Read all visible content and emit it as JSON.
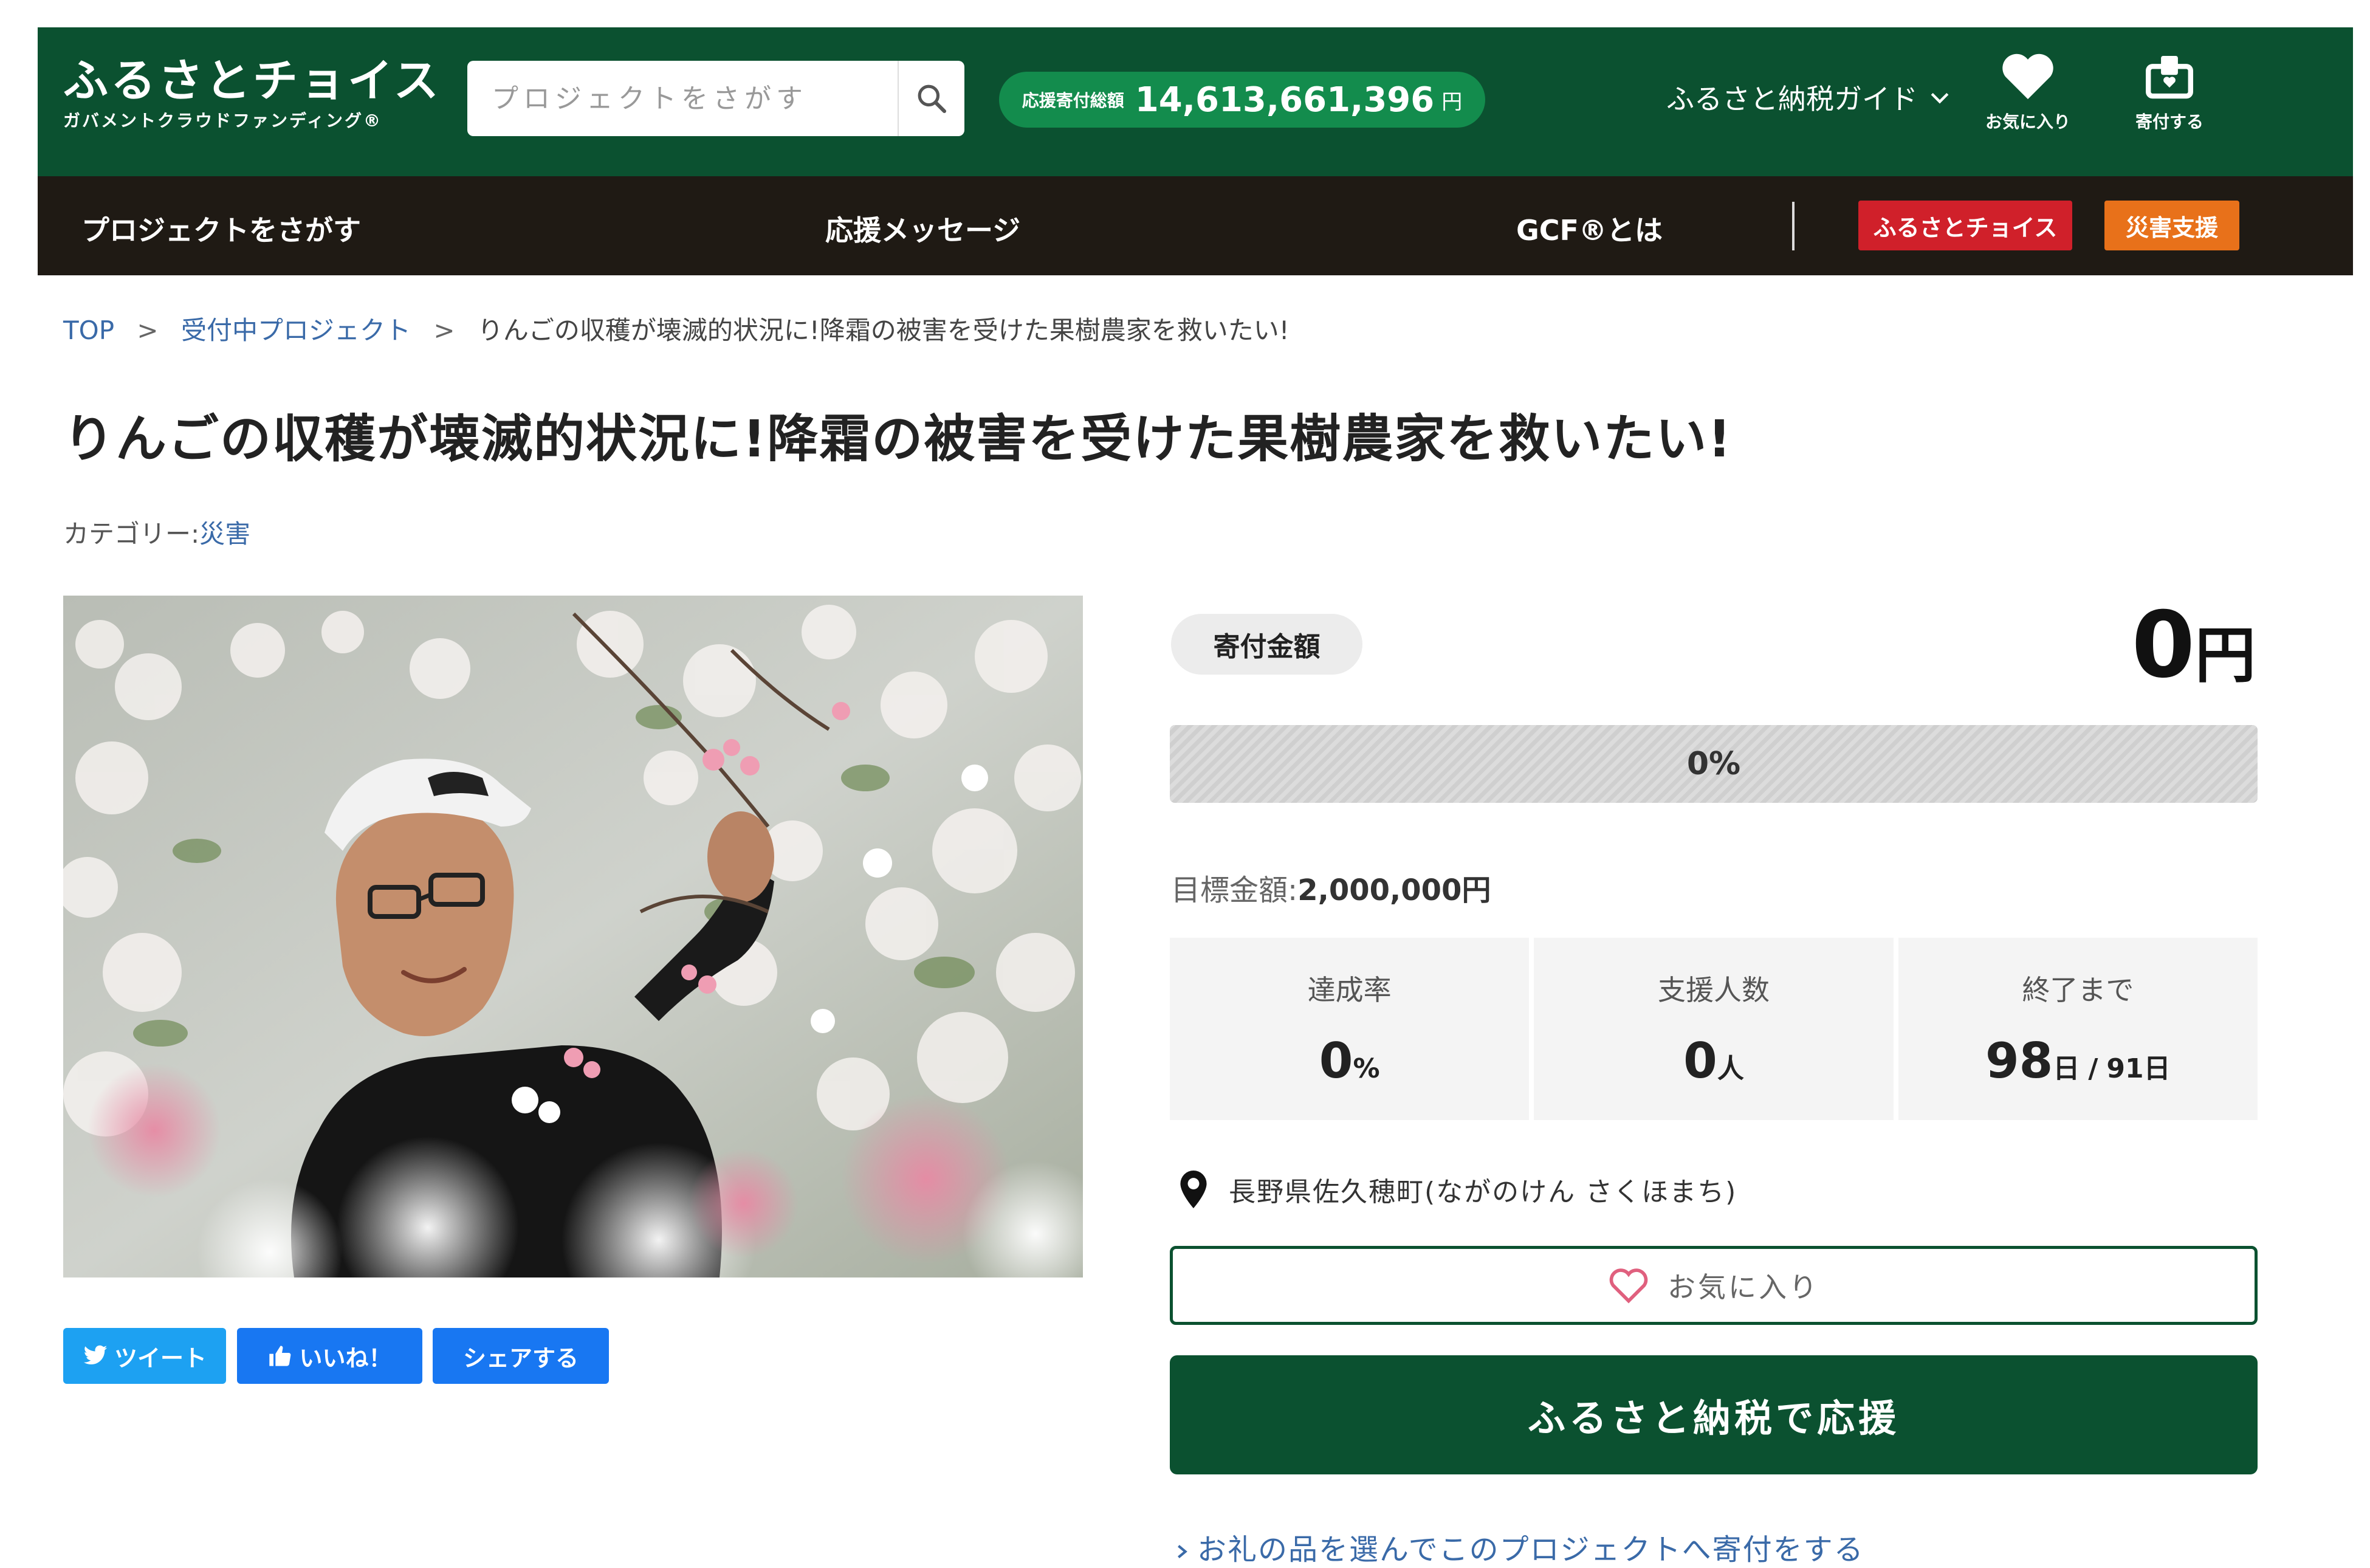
{
  "header": {
    "logo_title": "ふるさとチョイス",
    "logo_subtitle": "ガバメントクラウドファンディング®",
    "search_placeholder": "プロジェクトをさがす",
    "donation_label": "応援寄付総額",
    "donation_amount": "14,613,661,396",
    "donation_unit": "円",
    "guide_label": "ふるさと納税ガイド",
    "favorites_label": "お気に入り",
    "donate_label": "寄付する"
  },
  "nav": {
    "search_projects": "プロジェクトをさがす",
    "messages": "応援メッセージ",
    "about_gcf": "GCF®とは",
    "furusato_choice": "ふるさとチョイス",
    "disaster_support": "災害支援"
  },
  "breadcrumb": {
    "top": "TOP",
    "accepting": "受付中プロジェクト",
    "current": "りんごの収穫が壊滅的状況に!降霜の被害を受けた果樹農家を救いたい!",
    "separator": ">"
  },
  "project": {
    "title": "りんごの収穫が壊滅的状況に!降霜の被害を受けた果樹農家を救いたい!",
    "category_label": "カテゴリー:",
    "category_value": "災害",
    "amount_label": "寄付金額",
    "amount_value": "0",
    "amount_unit": "円",
    "progress_text": "0%",
    "progress_fraction": 0,
    "goal_label": "目標金額:",
    "goal_value": "2,000,000円",
    "stats": {
      "rate_label": "達成率",
      "rate_value": "0",
      "rate_unit": "%",
      "supporters_label": "支援人数",
      "supporters_value": "0",
      "supporters_unit": "人",
      "remaining_label": "終了まで",
      "remaining_days": "98",
      "remaining_days_unit": "日",
      "remaining_sep": "/",
      "total_days": "91",
      "total_days_unit": "日"
    },
    "location": "長野県佐久穂町(ながのけん さくほまち)",
    "favorite_button": "お気に入り",
    "support_button": "ふるさと納税で応援",
    "gift_link": "お礼の品を選んでこのプロジェクトへ寄付をする"
  },
  "share": {
    "tweet": "ツイート",
    "like": "いいね！",
    "share": "シェアする"
  },
  "colors": {
    "header_green": "#0b5130",
    "pill_green": "#138c4d",
    "nav_dark": "#1f1a14",
    "choice_red": "#d0202a",
    "disaster_orange": "#e8711a",
    "twitter_blue": "#1da1f2",
    "facebook_blue": "#1877f2",
    "link_blue": "#3a6aa8"
  },
  "icons": [
    "search-icon",
    "chevron-down-icon",
    "heart-icon",
    "donate-box-icon",
    "location-pin-icon",
    "heart-outline-icon",
    "twitter-bird-icon",
    "thumbs-up-icon",
    "chevron-right-icon"
  ]
}
